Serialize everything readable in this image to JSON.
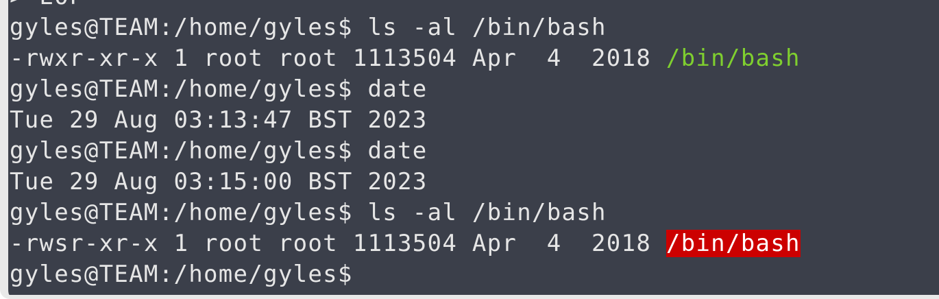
{
  "terminal": {
    "prompt": "gyles@TEAM:/home/gyles$",
    "lines": [
      {
        "kind": "partial",
        "text": "> EOF"
      },
      {
        "kind": "command",
        "command": "ls -al /bin/bash"
      },
      {
        "kind": "listing",
        "prefix": "-rwxr-xr-x 1 root root 1113504 Apr  4  2018 ",
        "file": "/bin/bash"
      },
      {
        "kind": "command",
        "command": "date"
      },
      {
        "kind": "output",
        "text": "Tue 29 Aug 03:13:47 BST 2023"
      },
      {
        "kind": "command",
        "command": "date"
      },
      {
        "kind": "output",
        "text": "Tue 29 Aug 03:15:00 BST 2023"
      },
      {
        "kind": "command",
        "command": "ls -al /bin/bash"
      },
      {
        "kind": "listing",
        "prefix": "-rwsr-xr-x 1 root root 1113504 Apr  4  2018 ",
        "file": "/bin/bash"
      },
      {
        "kind": "prompt",
        "command": ""
      }
    ]
  },
  "colors": {
    "background": "#3b3f4a",
    "text": "#e6e6e6",
    "executable_file": "#7fcf2f",
    "setuid_highlight": "#cc0000"
  }
}
